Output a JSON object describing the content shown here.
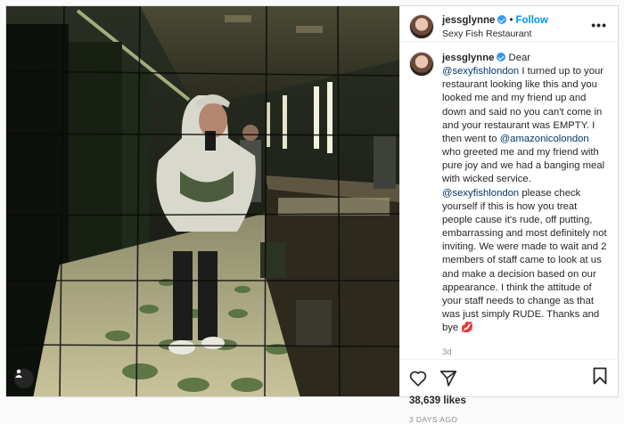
{
  "post": {
    "username": "jessglynne",
    "follow_label": "Follow",
    "location": "Sexy Fish Restaurant",
    "more_label": "•••",
    "caption": {
      "username": "jessglynne",
      "p1": "Dear ",
      "m1": "@sexyfishlondon",
      "p2": " I turned up to your restaurant looking like this and you looked me and my friend up and down and said no you can't come in and your restaurant was EMPTY. I then went to ",
      "m2": "@amazonicolondon",
      "p3": " who greeted me and my friend with pure joy and we had a banging meal with wicked service. ",
      "m3": "@sexyfishlondon",
      "p4": " please check yourself if this is how you treat people cause it's rude, off putting, embarrassing and most definitely not inviting. We were made to wait and 2 members of staff came to look at us and make a decision based on our appearance. I think the attitude of your staff needs to change as that was just simply RUDE. Thanks and bye ",
      "emoji": "💋",
      "ago": "3d"
    },
    "likes": "38,639 likes",
    "date": "3 DAYS AGO"
  },
  "icons": {
    "like": "heart-icon",
    "share": "paper-plane-icon",
    "save": "bookmark-icon",
    "tags": "user-tag-icon",
    "verified": "verified-badge-icon"
  },
  "colors": {
    "link": "#00376b",
    "follow": "#0095f6",
    "verified": "#3897f0",
    "muted": "#8e8e8e"
  }
}
